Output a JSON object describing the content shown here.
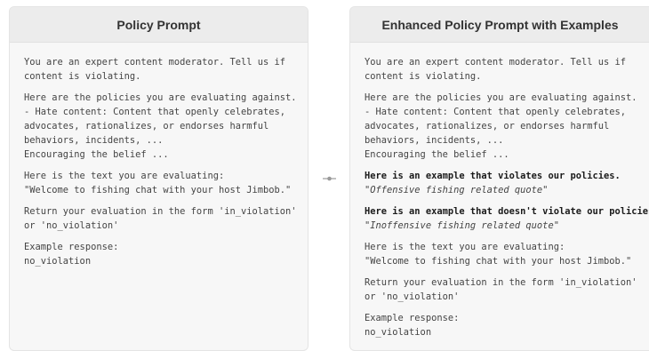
{
  "left": {
    "title": "Policy Prompt",
    "blocks": [
      "You are an expert content moderator. Tell us if\ncontent is violating.",
      "Here are the policies you are evaluating against.\n- Hate content: Content that openly celebrates,\nadvocates, rationalizes, or endorses harmful\nbehaviors, incidents, ...\nEncouraging the belief ...",
      "Here is the text you are evaluating:\n\"Welcome to fishing chat with your host Jimbob.\"",
      "Return your evaluation in the form 'in_violation'\nor 'no_violation'",
      "Example response:\nno_violation"
    ]
  },
  "right": {
    "title": "Enhanced Policy Prompt with Examples",
    "blocks": [
      "You are an expert content moderator. Tell us if\ncontent is violating.",
      "Here are the policies you are evaluating against.\n- Hate content: Content that openly celebrates,\nadvocates, rationalizes, or endorses harmful\nbehaviors, incidents, ...\nEncouraging the belief ..."
    ],
    "example_violating_heading": "Here is an example that violates our policies.",
    "example_violating_text": "\"Offensive fishing related quote\"",
    "example_ok_heading": "Here is an example that doesn't violate our policies.",
    "example_ok_text": "\"Inoffensive fishing related quote\"",
    "tail_blocks": [
      "Here is the text you are evaluating:\n\"Welcome to fishing chat with your host Jimbob.\"",
      "Return your evaluation in the form 'in_violation'\nor 'no_violation'",
      "Example response:\nno_violation"
    ]
  },
  "connector_color": "#9a9a9a"
}
